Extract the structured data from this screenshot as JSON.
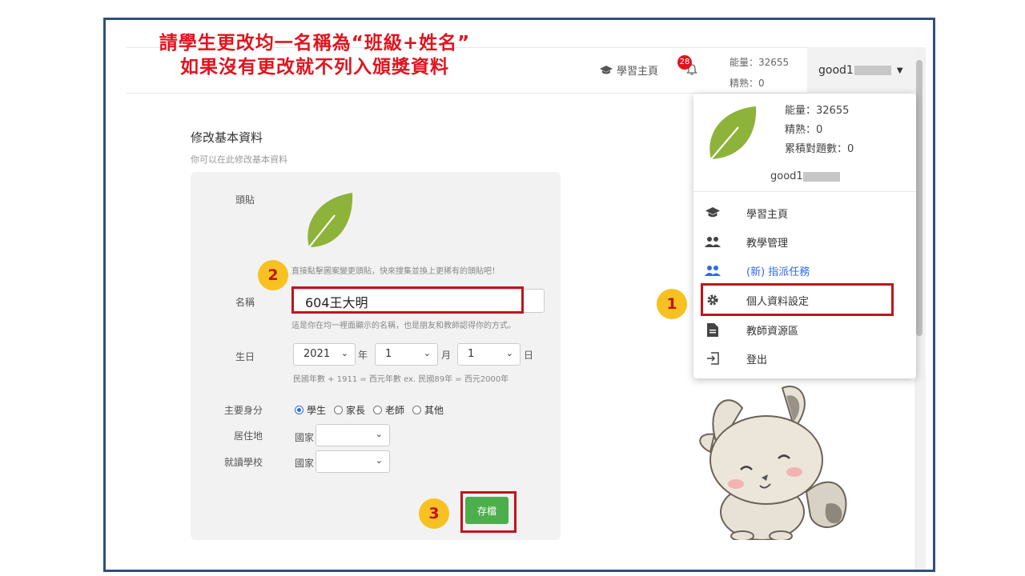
{
  "annotation": {
    "title_line1": "請學生更改均一名稱為“班級+姓名”",
    "title_line2": "如果沒有更改就不列入頒獎資料",
    "step1": "1",
    "step2": "2",
    "step3": "3"
  },
  "navbar": {
    "home_label": "學習主頁",
    "notification_count": "28",
    "energy": "能量：32655",
    "proficiency": "精熟：0",
    "username": "good1"
  },
  "form": {
    "title": "修改基本資料",
    "subtitle": "你可以在此修改基本資料",
    "avatar_label": "頭貼",
    "avatar_help": "直接點擊圖案變更頭貼，快來搜集並換上更稀有的頭貼吧！",
    "name_label": "名稱",
    "name_value": "604王大明",
    "name_help": "這是你在均一裡面顯示的名稱，也是朋友和教師認得你的方式。",
    "birthday_label": "生日",
    "year_value": "2021",
    "year_unit": "年",
    "month_value": "1",
    "month_unit": "月",
    "day_value": "1",
    "day_unit": "日",
    "birthday_help": "民國年數 + 1911 = 西元年數 ex. 民國89年 = 西元2000年",
    "role_label": "主要身分",
    "roles": [
      "學生",
      "家長",
      "老師",
      "其他"
    ],
    "selected_role": "學生",
    "residence_label": "居住地",
    "residence_country": "國家",
    "school_label": "就讀學校",
    "school_country": "國家",
    "save_label": "存檔"
  },
  "dropdown": {
    "energy": "能量：32655",
    "proficiency": "精熟：0",
    "correct_count": "累積對題數：0",
    "username": "good1",
    "items": [
      {
        "label": "學習主頁",
        "icon": "graduation-cap-icon"
      },
      {
        "label": "教學管理",
        "icon": "users-icon"
      },
      {
        "label": "(新) 指派任務",
        "icon": "users-icon"
      },
      {
        "label": "個人資料設定",
        "icon": "gear-icon"
      },
      {
        "label": "教師資源區",
        "icon": "document-icon"
      },
      {
        "label": "登出",
        "icon": "logout-icon"
      }
    ]
  },
  "colors": {
    "annotation_red": "#e0141e",
    "frame_blue": "#2f4f7f",
    "save_green": "#4cae4c",
    "badge_yellow": "#f7c121",
    "link_blue": "#2d6be4",
    "leaf_green": "#8db33a"
  }
}
